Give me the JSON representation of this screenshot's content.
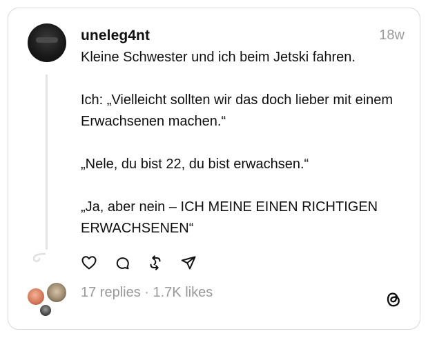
{
  "post": {
    "username": "uneleg4nt",
    "time": "18w",
    "paragraphs": [
      "Kleine Schwester und ich beim Jetski fahren.",
      "Ich: „Vielleicht sollten wir das doch lieber mit einem Erwachsenen machen.“",
      "„Nele, du bist 22, du bist erwachsen.“",
      "„Ja, aber nein – ICH MEINE EINEN RICHTIGEN ERWACHSENEN“"
    ]
  },
  "actions": [
    {
      "icon": "heart-icon"
    },
    {
      "icon": "comment-icon"
    },
    {
      "icon": "repost-icon"
    },
    {
      "icon": "share-icon"
    }
  ],
  "stats": {
    "replies": "17 replies",
    "separator": " · ",
    "likes": "1.7K likes"
  },
  "brand": {
    "logo": "threads-logo-icon",
    "accent": "#101010",
    "muted": "#999999"
  }
}
